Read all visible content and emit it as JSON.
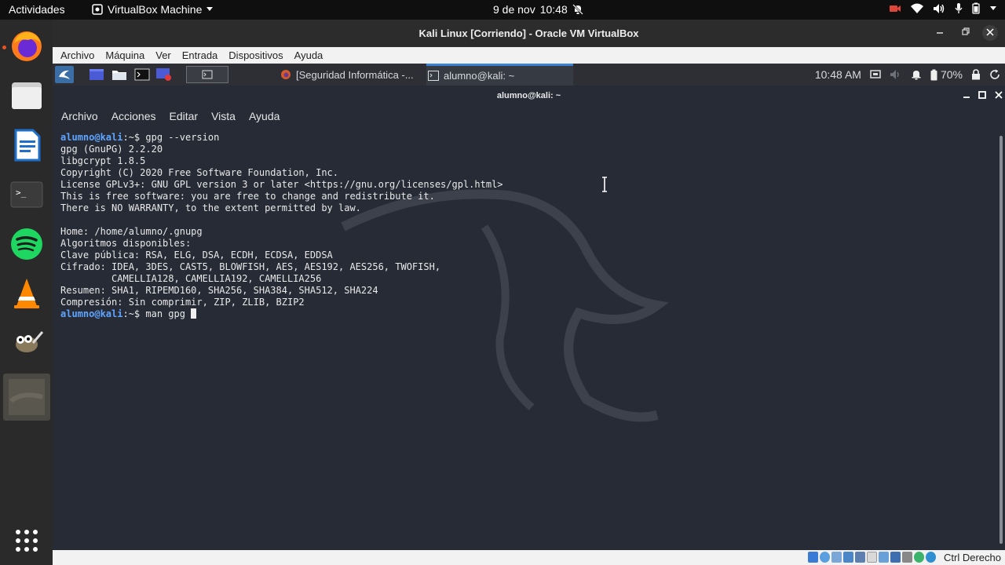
{
  "topbar": {
    "activities": "Actividades",
    "app_name": "VirtualBox Machine",
    "date": "9 de nov",
    "time": "10:48"
  },
  "dock": {
    "items": [
      {
        "name": "firefox-icon"
      },
      {
        "name": "files-icon"
      },
      {
        "name": "libreoffice-writer-icon"
      },
      {
        "name": "terminal-icon"
      },
      {
        "name": "spotify-icon"
      },
      {
        "name": "vlc-icon"
      },
      {
        "name": "gimp-icon"
      },
      {
        "name": "virtualbox-machine-icon"
      }
    ],
    "show_apps_icon": "grid-icon"
  },
  "vbox": {
    "title": "Kali Linux [Corriendo] - Oracle VM VirtualBox",
    "menu": [
      "Archivo",
      "Máquina",
      "Ver",
      "Entrada",
      "Dispositivos",
      "Ayuda"
    ],
    "host_key": "Ctrl Derecho"
  },
  "kali_panel": {
    "tasks": [
      {
        "label": "[Seguridad Informática -...",
        "icon": "firefox-icon"
      },
      {
        "label": "alumno@kali: ~",
        "icon": "terminal-icon"
      }
    ],
    "clock": "10:48 AM",
    "battery": "70%"
  },
  "terminal": {
    "title": "alumno@kali: ~",
    "menu": [
      "Archivo",
      "Acciones",
      "Editar",
      "Vista",
      "Ayuda"
    ],
    "prompt_user": "alumno@kali",
    "prompt_suffix": ":~$ ",
    "command1": "gpg --version",
    "output": [
      "gpg (GnuPG) 2.2.20",
      "libgcrypt 1.8.5",
      "Copyright (C) 2020 Free Software Foundation, Inc.",
      "License GPLv3+: GNU GPL version 3 or later <https://gnu.org/licenses/gpl.html>",
      "This is free software: you are free to change and redistribute it.",
      "There is NO WARRANTY, to the extent permitted by law.",
      "",
      "Home: /home/alumno/.gnupg",
      "Algoritmos disponibles:",
      "Clave pública: RSA, ELG, DSA, ECDH, ECDSA, EDDSA",
      "Cifrado: IDEA, 3DES, CAST5, BLOWFISH, AES, AES192, AES256, TWOFISH,",
      "         CAMELLIA128, CAMELLIA192, CAMELLIA256",
      "Resumen: SHA1, RIPEMD160, SHA256, SHA384, SHA512, SHA224",
      "Compresión: Sin comprimir, ZIP, ZLIB, BZIP2"
    ],
    "command2": "man gpg "
  }
}
